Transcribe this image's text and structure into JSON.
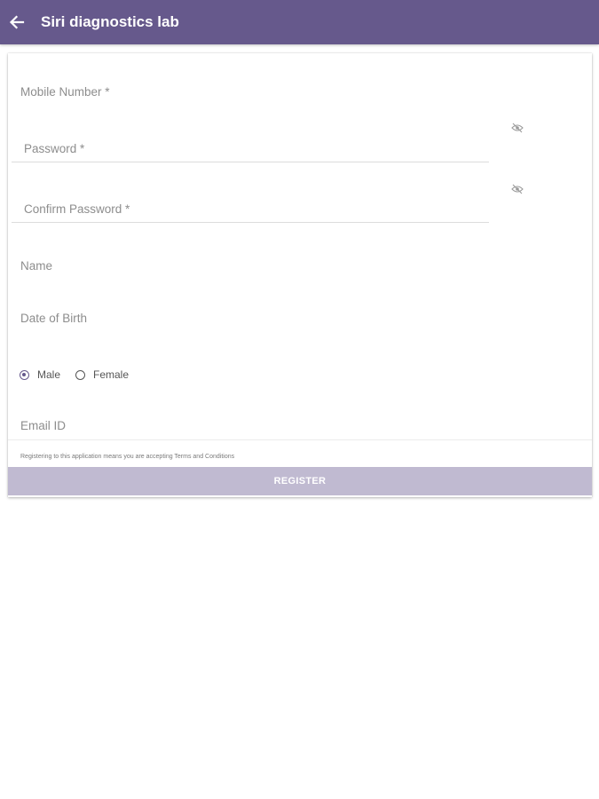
{
  "appbar": {
    "title": "Siri diagnostics lab",
    "back_icon": "arrow-left-icon",
    "background": "#66598c"
  },
  "form": {
    "mobile_label": "Mobile Number *",
    "password_placeholder": "Password *",
    "confirm_password_placeholder": "Confirm Password *",
    "name_label": "Name",
    "dob_label": "Date of Birth",
    "gender": {
      "options": [
        "Male",
        "Female"
      ],
      "selected": "Male"
    },
    "email_label": "Email ID",
    "toggle_icon": "eye-off-icon"
  },
  "footer": {
    "terms_text": "Registering to this application means you are accepting Terms and Conditions",
    "register_label": "REGISTER",
    "button_color": "#c0bad1"
  }
}
